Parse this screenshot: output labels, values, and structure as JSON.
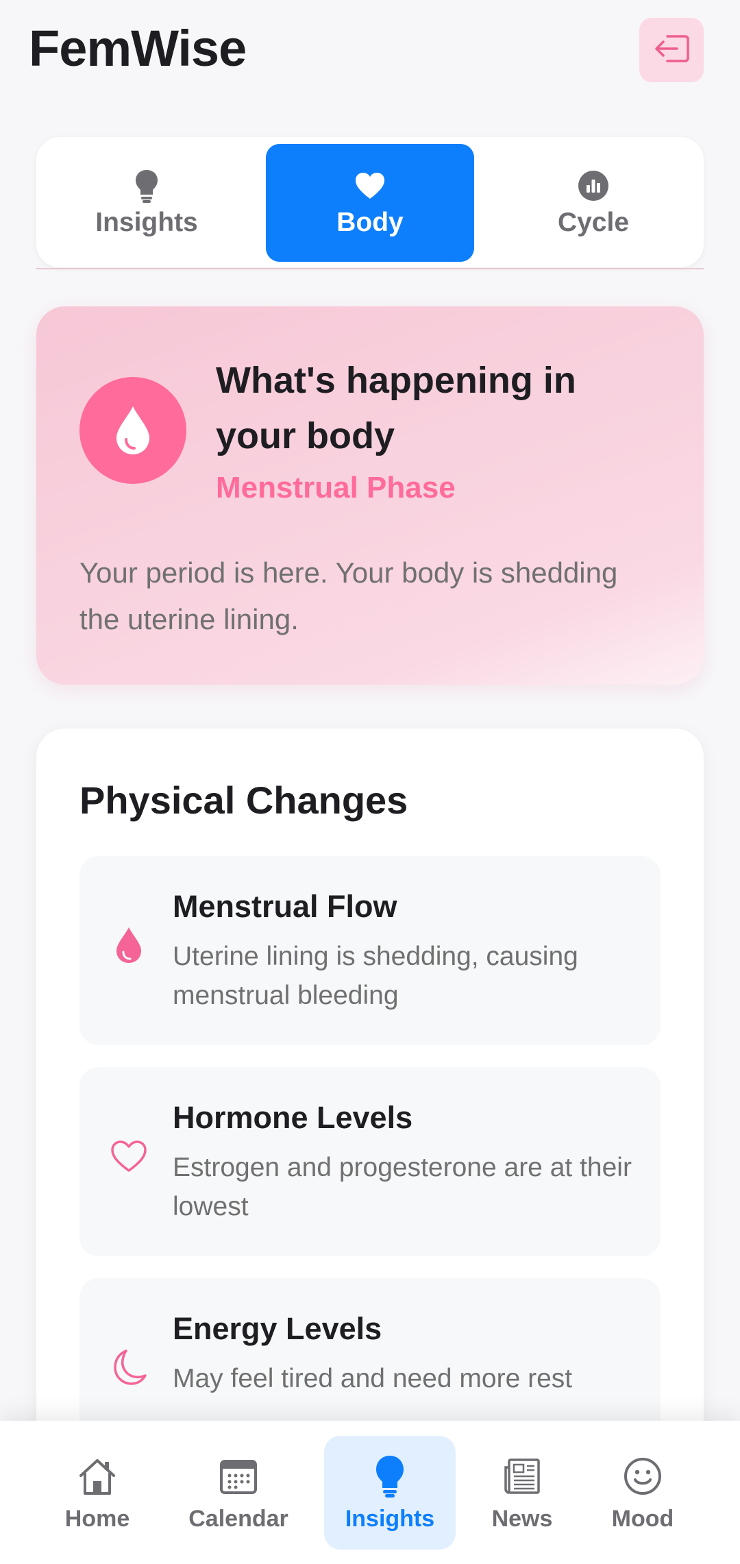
{
  "app": {
    "title": "FemWise"
  },
  "header": {
    "logout_icon": "logout-icon"
  },
  "tabs": [
    {
      "label": "Insights",
      "icon": "lightbulb-icon",
      "active": false
    },
    {
      "label": "Body",
      "icon": "heart-icon",
      "active": true
    },
    {
      "label": "Cycle",
      "icon": "chart-circle-icon",
      "active": false
    }
  ],
  "hero": {
    "icon": "drop-icon",
    "title": "What's happening in your body",
    "phase": "Menstrual Phase",
    "description": "Your period is here. Your body is shedding the uterine lining."
  },
  "physical_changes": {
    "title": "Physical Changes",
    "items": [
      {
        "icon": "drop-icon",
        "name": "Menstrual Flow",
        "description": "Uterine lining is shedding, causing menstrual bleeding"
      },
      {
        "icon": "heart-outline-icon",
        "name": "Hormone Levels",
        "description": "Estrogen and progesterone are at their lowest"
      },
      {
        "icon": "moon-icon",
        "name": "Energy Levels",
        "description": "May feel tired and need more rest"
      }
    ]
  },
  "bottom_nav": [
    {
      "label": "Home",
      "icon": "home-icon",
      "active": false
    },
    {
      "label": "Calendar",
      "icon": "calendar-icon",
      "active": false
    },
    {
      "label": "Insights",
      "icon": "lightbulb-icon",
      "active": true
    },
    {
      "label": "News",
      "icon": "newspaper-icon",
      "active": false
    },
    {
      "label": "Mood",
      "icon": "smiley-icon",
      "active": false
    }
  ],
  "colors": {
    "accent_blue": "#0d7ffc",
    "accent_pink": "#ff6b9a",
    "hero_bg": "#f8d2de",
    "text_primary": "#1e1e22",
    "text_secondary": "#707070"
  }
}
